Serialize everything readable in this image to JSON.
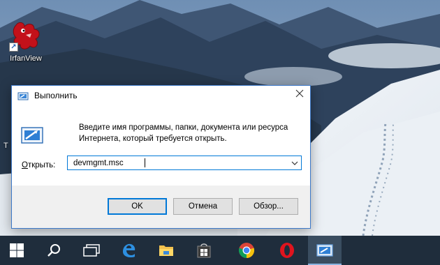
{
  "desktop": {
    "shortcut": {
      "label": "IrfanView",
      "icon": "irfanview-icon"
    },
    "stray_text": "T"
  },
  "run_dialog": {
    "title": "Выполнить",
    "description": "Введите имя программы, папки, документа или ресурса Интернета, который требуется открыть.",
    "open_label_mnemonic": "О",
    "open_label_rest": "ткрыть:",
    "input_value": "devmgmt.msc",
    "buttons": {
      "ok": "OK",
      "cancel": "Отмена",
      "browse": "Обзор..."
    }
  },
  "taskbar": {
    "items": [
      {
        "icon": "windows-start-icon"
      },
      {
        "icon": "search-icon"
      },
      {
        "icon": "task-view-icon"
      },
      {
        "icon": "edge-icon"
      },
      {
        "icon": "file-explorer-icon"
      },
      {
        "icon": "store-icon"
      },
      {
        "icon": "chrome-icon"
      },
      {
        "icon": "opera-icon"
      },
      {
        "icon": "run-icon",
        "active": true
      }
    ]
  },
  "colors": {
    "accent": "#0078d7",
    "taskbar": "#1f2d3c",
    "dialog_footer": "#f0f0f0"
  }
}
